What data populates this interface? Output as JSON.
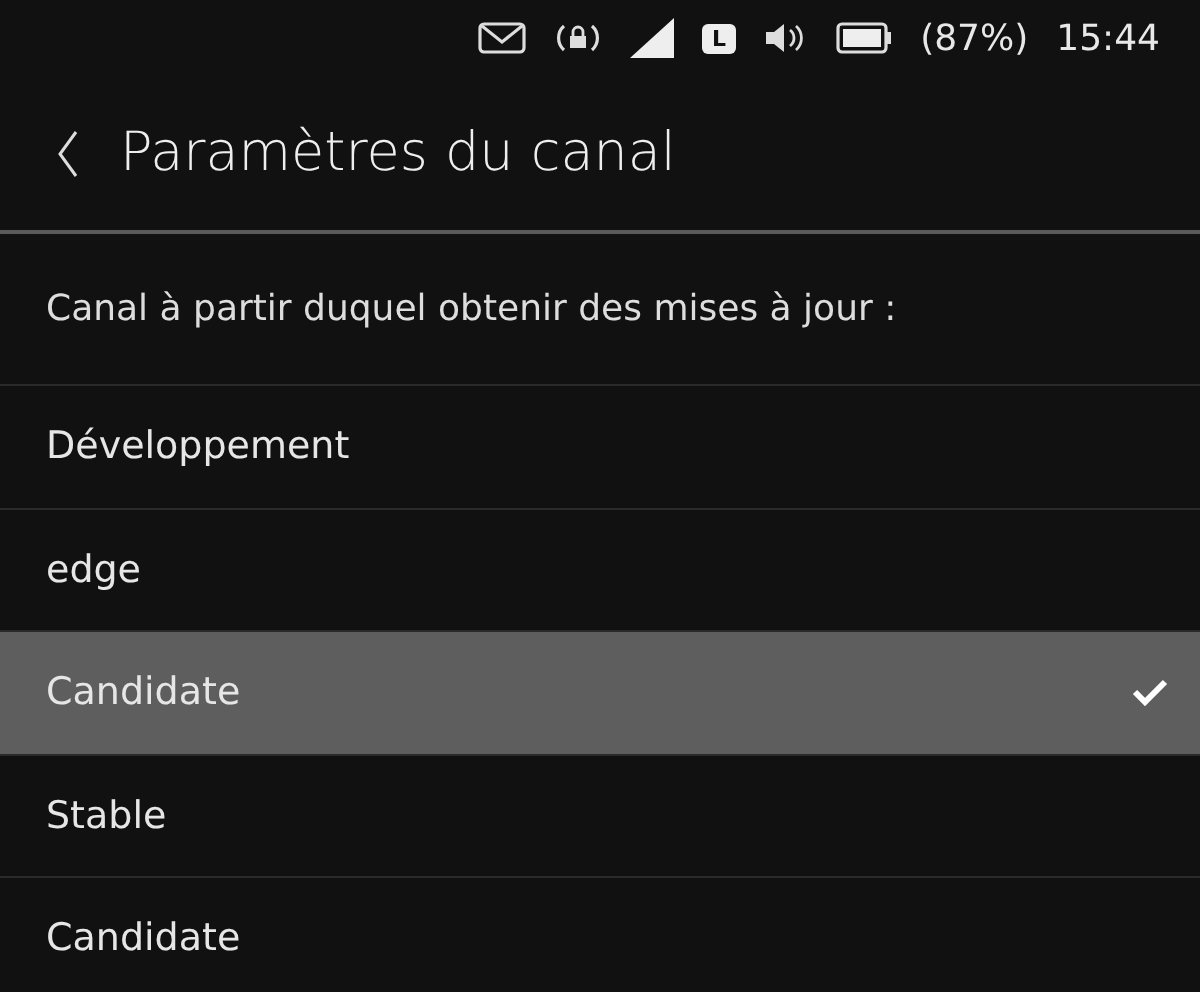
{
  "status_bar": {
    "network_badge": "L",
    "battery_percent": "(87%)",
    "time": "15:44"
  },
  "header": {
    "title": "Paramètres du canal"
  },
  "prompt": "Canal à partir duquel obtenir des mises à jour :",
  "channels": [
    {
      "label": "Développement",
      "selected": false
    },
    {
      "label": "edge",
      "selected": false
    },
    {
      "label": "Candidate",
      "selected": true
    },
    {
      "label": "Stable",
      "selected": false
    },
    {
      "label": "Candidate",
      "selected": false
    }
  ]
}
